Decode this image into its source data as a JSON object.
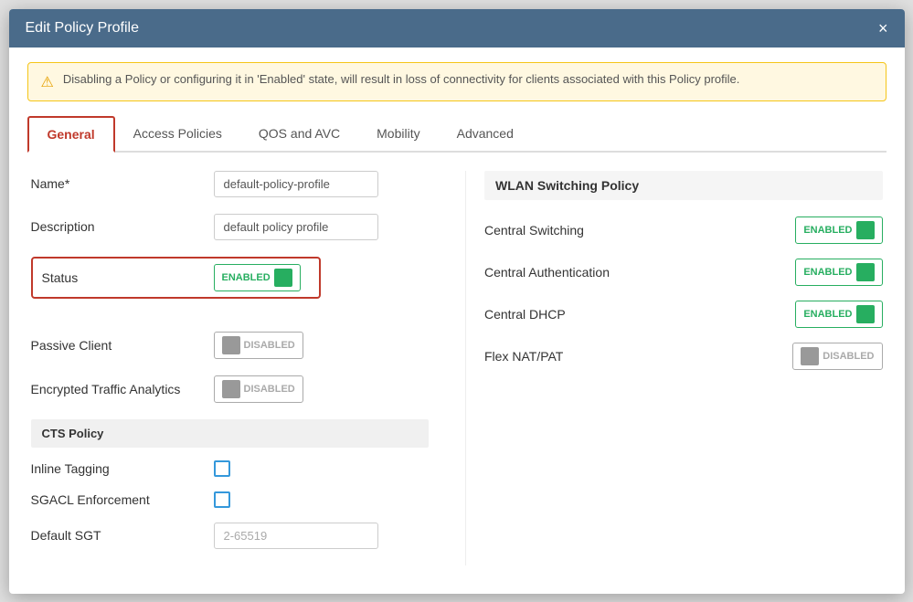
{
  "modal": {
    "title": "Edit Policy Profile",
    "close_label": "×"
  },
  "alert": {
    "message": "Disabling a Policy or configuring it in 'Enabled' state, will result in loss of connectivity for clients associated with this Policy profile.",
    "icon": "⚠"
  },
  "tabs": [
    {
      "id": "general",
      "label": "General",
      "active": true
    },
    {
      "id": "access-policies",
      "label": "Access Policies",
      "active": false
    },
    {
      "id": "qos-avc",
      "label": "QOS and AVC",
      "active": false
    },
    {
      "id": "mobility",
      "label": "Mobility",
      "active": false
    },
    {
      "id": "advanced",
      "label": "Advanced",
      "active": false
    }
  ],
  "form": {
    "name_label": "Name*",
    "name_value": "default-policy-profile",
    "description_label": "Description",
    "description_value": "default policy profile",
    "status_label": "Status",
    "status_value": "ENABLED",
    "passive_client_label": "Passive Client",
    "passive_client_value": "DISABLED",
    "encrypted_traffic_label": "Encrypted Traffic Analytics",
    "encrypted_traffic_value": "DISABLED"
  },
  "cts_policy": {
    "section_title": "CTS Policy",
    "inline_tagging_label": "Inline Tagging",
    "sgacl_enforcement_label": "SGACL Enforcement",
    "default_sgt_label": "Default SGT",
    "default_sgt_placeholder": "2-65519"
  },
  "wlan_switching": {
    "section_title": "WLAN Switching Policy",
    "central_switching_label": "Central Switching",
    "central_switching_value": "ENABLED",
    "central_auth_label": "Central Authentication",
    "central_auth_value": "ENABLED",
    "central_dhcp_label": "Central DHCP",
    "central_dhcp_value": "ENABLED",
    "flex_nat_label": "Flex NAT/PAT",
    "flex_nat_value": "DISABLED"
  }
}
